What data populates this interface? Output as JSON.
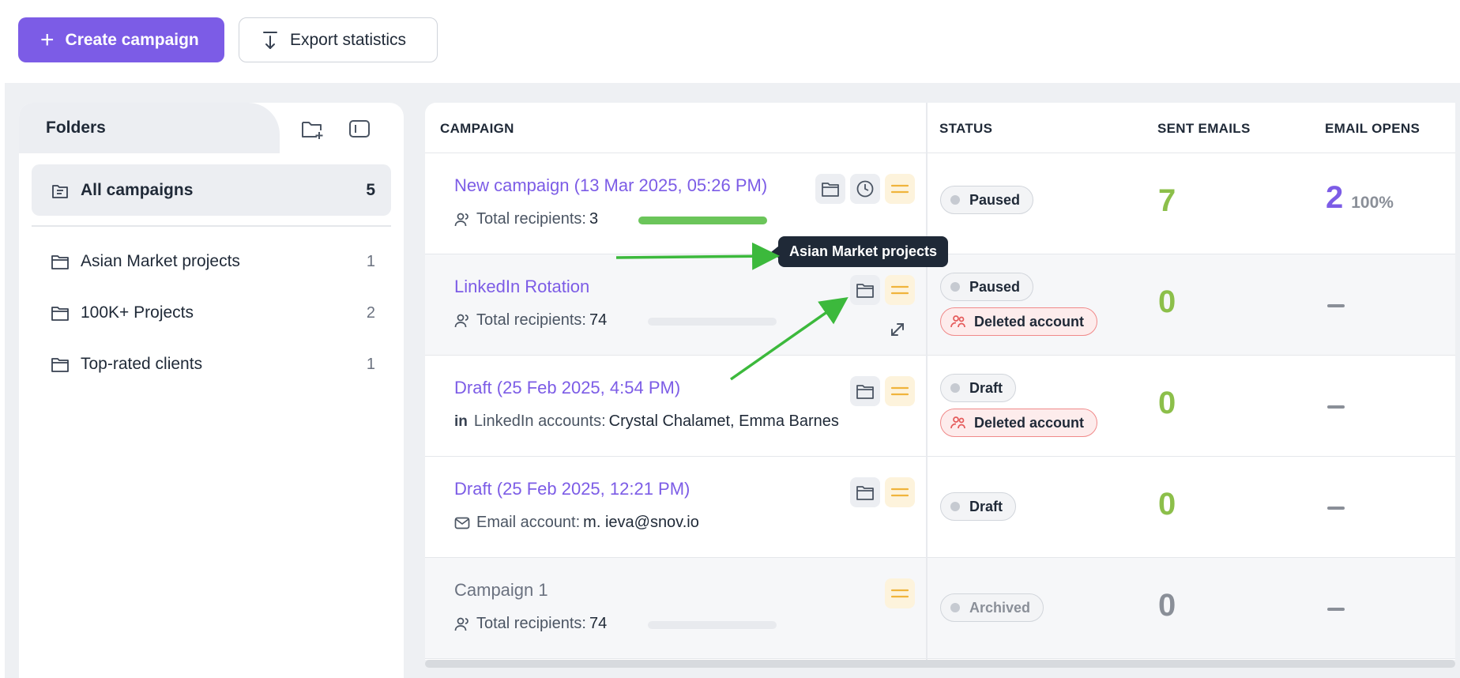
{
  "toolbar": {
    "create_label": "Create campaign",
    "export_label": "Export statistics"
  },
  "folders": {
    "title": "Folders",
    "all": {
      "label": "All campaigns",
      "count": "5"
    },
    "items": [
      {
        "label": "Asian Market projects",
        "count": "1"
      },
      {
        "label": "100K+ Projects",
        "count": "2"
      },
      {
        "label": "Top-rated clients",
        "count": "1"
      }
    ]
  },
  "table": {
    "headers": {
      "campaign": "CAMPAIGN",
      "status": "STATUS",
      "sent": "SENT EMAILS",
      "opens": "EMAIL OPENS"
    },
    "rows": [
      {
        "name": "New campaign (13 Mar 2025, 05:26 PM)",
        "meta_label": "Total recipients:",
        "meta_value": "3",
        "progress": 1.0,
        "status": "Paused",
        "sent": "7",
        "opens": "2",
        "opens_pct": "100%"
      },
      {
        "name": "LinkedIn Rotation",
        "meta_label": "Total recipients:",
        "meta_value": "74",
        "progress": 0.0,
        "status": "Paused",
        "status2": "Deleted account",
        "sent": "0"
      },
      {
        "name": "Draft (25 Feb 2025, 4:54 PM)",
        "meta_label": "LinkedIn accounts:",
        "meta_value": "Crystal Chalamet, Emma Barnes",
        "status": "Draft",
        "status2": "Deleted account",
        "sent": "0"
      },
      {
        "name": "Draft (25 Feb 2025, 12:21 PM)",
        "meta_label": "Email account:",
        "meta_value": "m.   ieva@snov.io",
        "status": "Draft",
        "sent": "0"
      },
      {
        "name": "Campaign 1",
        "meta_label": "Total recipients:",
        "meta_value": "74",
        "progress": 0.0,
        "status": "Archived",
        "sent": "0"
      }
    ]
  },
  "tooltip": {
    "text": "Asian Market projects"
  },
  "colors": {
    "accent": "#7c5ce6",
    "sent_green": "#8cbf4a",
    "annotation_arrow": "#3cb93c"
  }
}
